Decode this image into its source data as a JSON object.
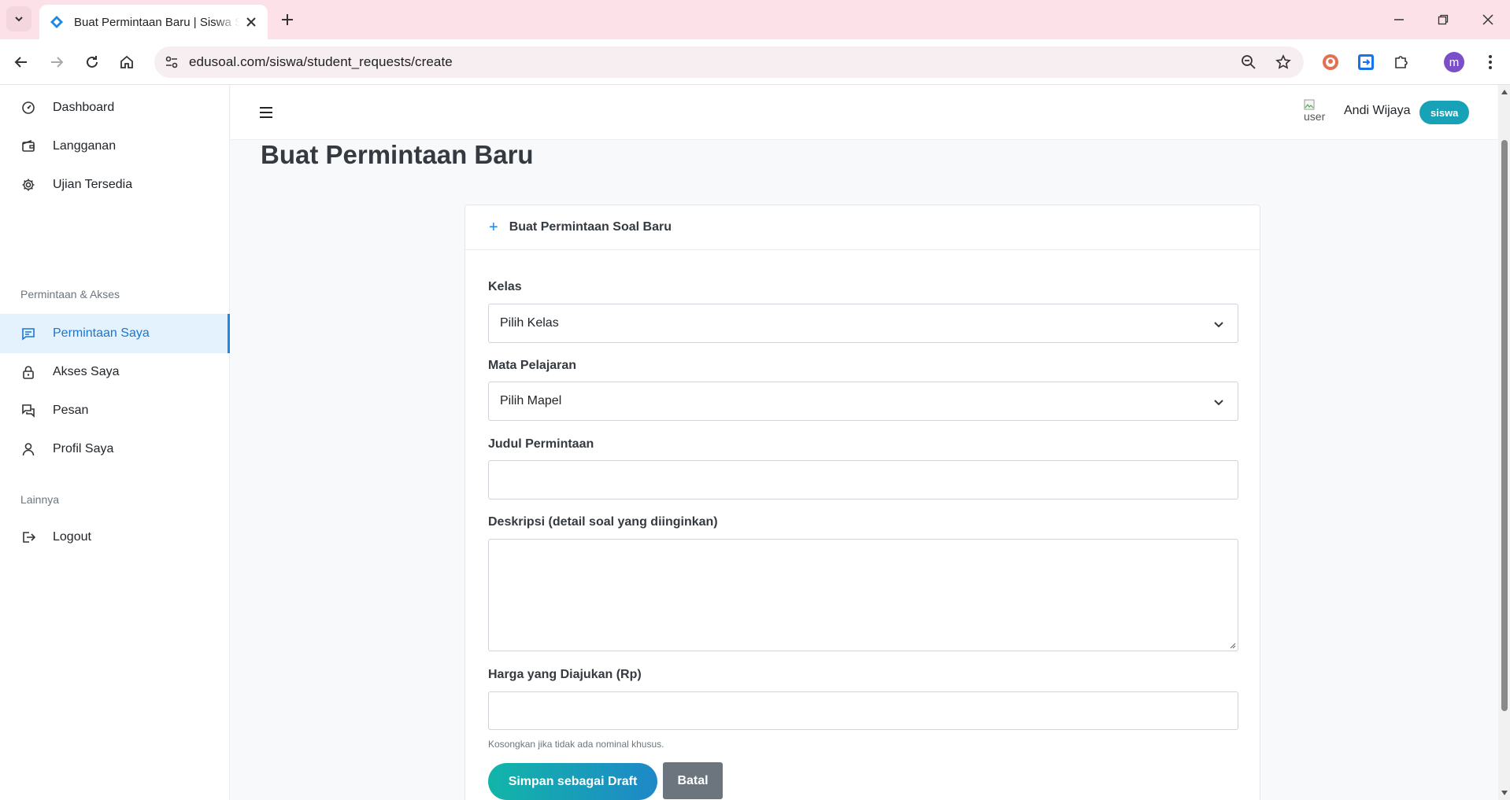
{
  "browser": {
    "tab_title": "Buat Permintaan Baru | Siswa Se",
    "url": "edusoal.com/siswa/student_requests/create",
    "profile_initial": "m"
  },
  "sidebar": {
    "items": [
      {
        "label": "Dashboard",
        "icon": "dashboard-icon"
      },
      {
        "label": "Langganan",
        "icon": "wallet-icon"
      },
      {
        "label": "Ujian Tersedia",
        "icon": "gear-icon"
      }
    ],
    "section_requests": "Permintaan & Akses",
    "request_items": [
      {
        "label": "Permintaan Saya",
        "icon": "chat-icon",
        "active": true
      },
      {
        "label": "Akses Saya",
        "icon": "lock-icon"
      },
      {
        "label": "Pesan",
        "icon": "messages-icon"
      },
      {
        "label": "Profil Saya",
        "icon": "user-icon"
      }
    ],
    "section_other": "Lainnya",
    "other_items": [
      {
        "label": "Logout",
        "icon": "logout-icon"
      }
    ]
  },
  "header": {
    "avatar_alt": "user",
    "user_name": "Andi Wijaya",
    "role": "siswa"
  },
  "page": {
    "title": "Buat Permintaan Baru"
  },
  "form": {
    "card_title": "Buat Permintaan Soal Baru",
    "kelas_label": "Kelas",
    "kelas_value": "Pilih Kelas",
    "mapel_label": "Mata Pelajaran",
    "mapel_value": "Pilih Mapel",
    "judul_label": "Judul Permintaan",
    "judul_value": "",
    "deskripsi_label": "Deskripsi (detail soal yang diinginkan)",
    "deskripsi_value": "",
    "harga_label": "Harga yang Diajukan (Rp)",
    "harga_value": "",
    "harga_help": "Kosongkan jika tidak ada nominal khusus.",
    "save_label": "Simpan sebagai Draft",
    "cancel_label": "Batal"
  },
  "colors": {
    "accent": "#1e88e5",
    "active_bg": "#e3f2fd",
    "badge": "#17a2b8",
    "secondary_button": "#6c757d",
    "browser_frame": "#fce1e8"
  }
}
